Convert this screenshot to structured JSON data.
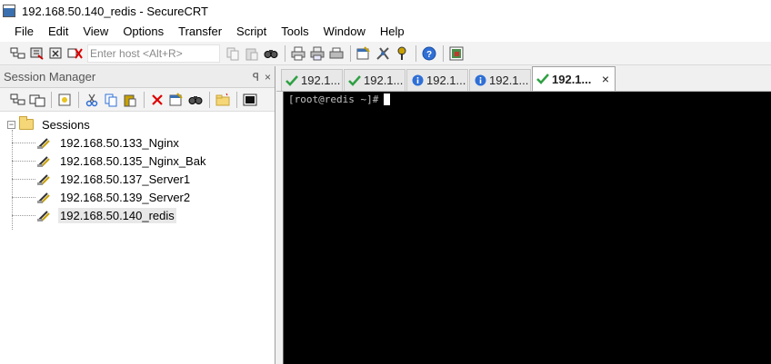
{
  "window": {
    "title": "192.168.50.140_redis - SecureCRT"
  },
  "menu": [
    "File",
    "Edit",
    "View",
    "Options",
    "Transfer",
    "Script",
    "Tools",
    "Window",
    "Help"
  ],
  "toolbar": {
    "host_placeholder": "Enter host <Alt+R>",
    "icons": [
      "connect-icon",
      "quick-connect-icon",
      "reconnect-icon",
      "disconnect-icon",
      "copy-icon",
      "paste-icon",
      "find-icon",
      "print-icon",
      "print-selection-icon",
      "printer-setup-icon",
      "session-options-icon",
      "global-options-icon",
      "keymap-icon",
      "help-icon",
      "sftp-icon"
    ]
  },
  "session_manager": {
    "title": "Session Manager",
    "pin_label": "ꟼ",
    "close_label": "×",
    "toolbar_icons": [
      "connect-icon",
      "connect-tab-icon",
      "new-session-icon",
      "cut-icon",
      "copy-icon",
      "paste-icon",
      "delete-icon",
      "properties-icon",
      "find-icon",
      "new-folder-icon",
      "session-window-icon"
    ],
    "root": {
      "label": "Sessions",
      "expander": "−"
    },
    "sessions": [
      {
        "label": "192.168.50.133_Nginx",
        "selected": false
      },
      {
        "label": "192.168.50.135_Nginx_Bak",
        "selected": false
      },
      {
        "label": "192.168.50.137_Server1",
        "selected": false
      },
      {
        "label": "192.168.50.139_Server2",
        "selected": false
      },
      {
        "label": "192.168.50.140_redis",
        "selected": true
      }
    ]
  },
  "tabs": [
    {
      "label": "192.1...",
      "status": "connected",
      "active": false
    },
    {
      "label": "192.1...",
      "status": "connected",
      "active": false
    },
    {
      "label": "192.1...",
      "status": "info",
      "active": false
    },
    {
      "label": "192.1...",
      "status": "info",
      "active": false
    },
    {
      "label": "192.1...",
      "status": "connected",
      "active": true,
      "close": "×"
    }
  ],
  "terminal": {
    "prompt": "[root@redis ~]#"
  },
  "colors": {
    "terminal_bg": "#000000",
    "terminal_fg": "#c0c0c0",
    "check_green": "#2ea043",
    "info_blue": "#2f6fd6"
  }
}
